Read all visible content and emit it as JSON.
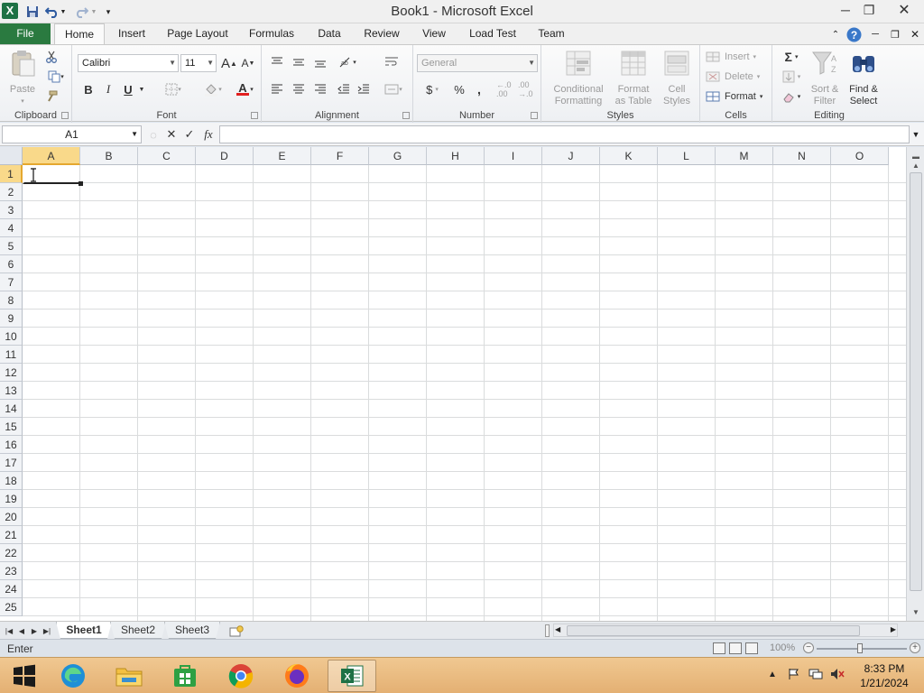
{
  "window": {
    "title": "Book1  -  Microsoft Excel"
  },
  "tabs": [
    "File",
    "Home",
    "Insert",
    "Page Layout",
    "Formulas",
    "Data",
    "Review",
    "View",
    "Load Test",
    "Team"
  ],
  "ribbon": {
    "clipboard": {
      "label": "Clipboard",
      "paste": "Paste"
    },
    "font": {
      "label": "Font",
      "name": "Calibri",
      "size": "11",
      "bold": "B",
      "italic": "I",
      "underline": "U"
    },
    "alignment": {
      "label": "Alignment"
    },
    "number": {
      "label": "Number",
      "format": "General",
      "currency": "$",
      "percent": "%",
      "comma": ",",
      "inc_decimal": "←.0 .00",
      "dec_decimal": ".00 →.0"
    },
    "styles": {
      "label": "Styles",
      "conditional": "Conditional Formatting",
      "conditional_l1": "Conditional",
      "conditional_l2": "Formatting",
      "format_table_l1": "Format",
      "format_table_l2": "as Table",
      "cell_styles_l1": "Cell",
      "cell_styles_l2": "Styles"
    },
    "cells": {
      "label": "Cells",
      "insert": "Insert",
      "delete": "Delete",
      "format": "Format"
    },
    "editing": {
      "label": "Editing",
      "sum": "Σ",
      "sort_l1": "Sort &",
      "sort_l2": "Filter",
      "find_l1": "Find &",
      "find_l2": "Select"
    }
  },
  "formula_bar": {
    "name_box": "A1",
    "fx": "fx",
    "value": ""
  },
  "grid": {
    "columns": [
      "A",
      "B",
      "C",
      "D",
      "E",
      "F",
      "G",
      "H",
      "I",
      "J",
      "K",
      "L",
      "M",
      "N",
      "O"
    ],
    "rows": [
      "1",
      "2",
      "3",
      "4",
      "5",
      "6",
      "7",
      "8",
      "9",
      "10",
      "11",
      "12",
      "13",
      "14",
      "15",
      "16",
      "17",
      "18",
      "19",
      "20",
      "21",
      "22",
      "23",
      "24",
      "25"
    ],
    "active_cell": "A1"
  },
  "sheets": [
    "Sheet1",
    "Sheet2",
    "Sheet3"
  ],
  "active_sheet": "Sheet1",
  "status": {
    "mode": "Enter",
    "zoom": "100%"
  },
  "taskbar": {
    "time": "8:33 PM",
    "date": "1/21/2024"
  },
  "colors": {
    "excel_green": "#2a7a40",
    "selected_header": "#f9d98a",
    "taskbar": "#e8b87a"
  }
}
